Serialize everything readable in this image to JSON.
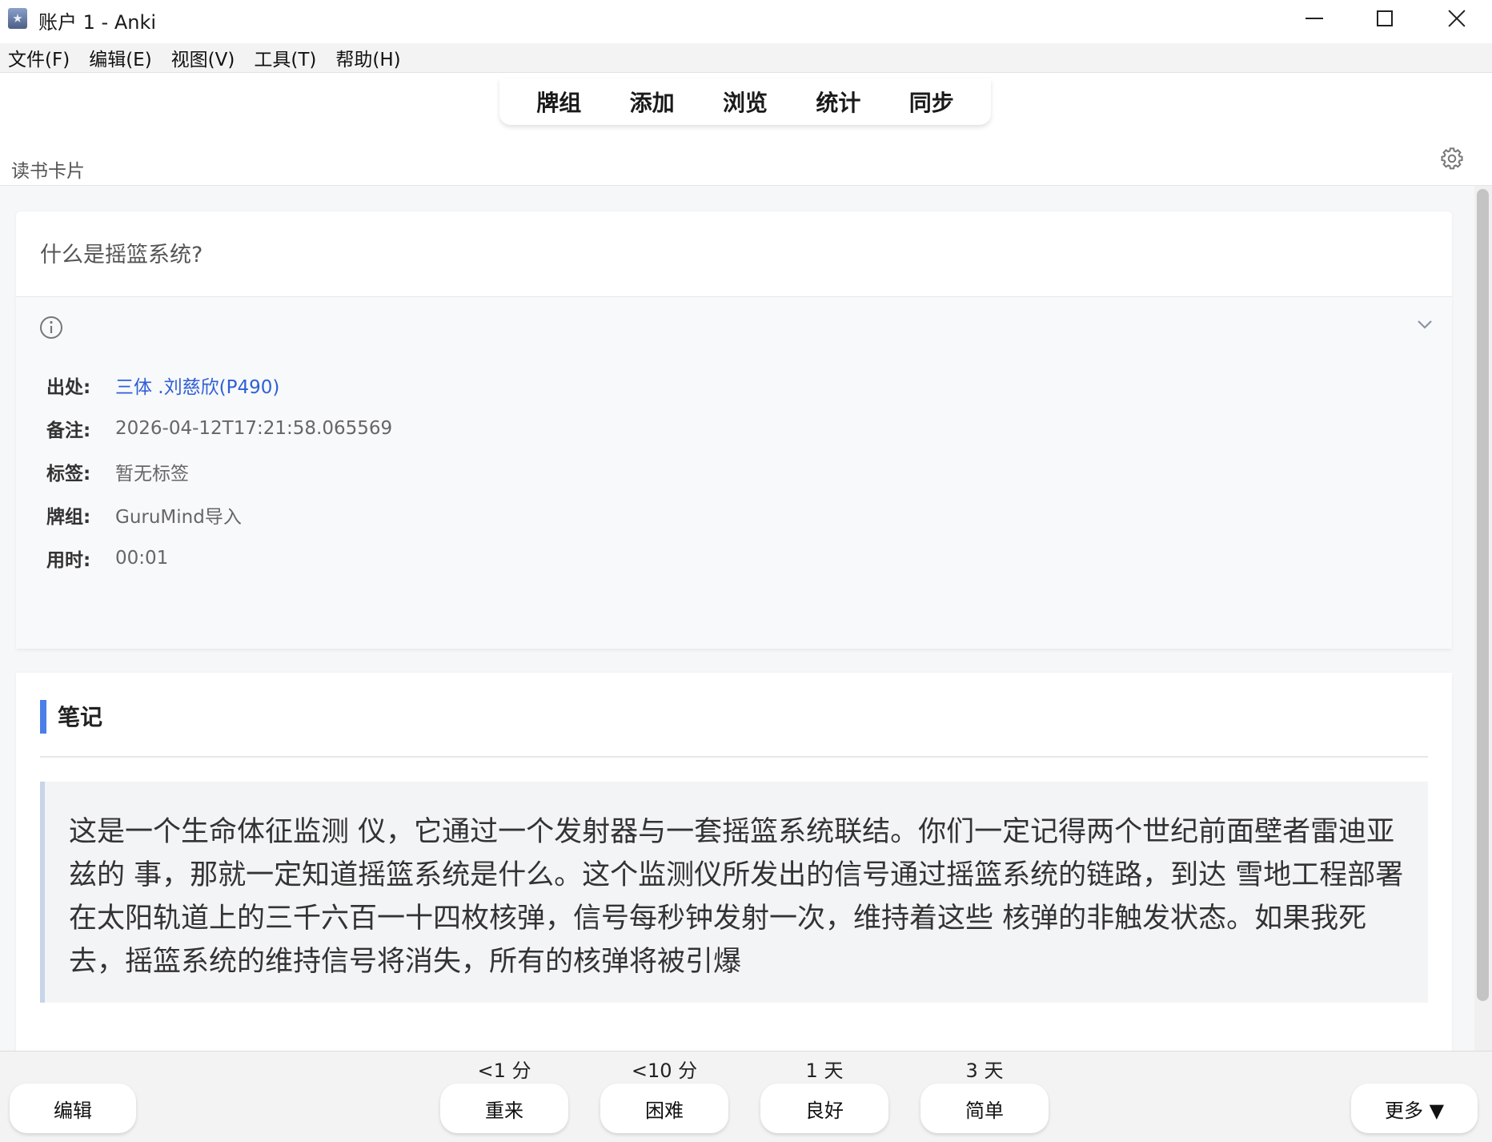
{
  "window": {
    "title": "账户 1 - Anki"
  },
  "menu": [
    "文件(F)",
    "编辑(E)",
    "视图(V)",
    "工具(T)",
    "帮助(H)"
  ],
  "toolbar": [
    "牌组",
    "添加",
    "浏览",
    "统计",
    "同步"
  ],
  "deck": {
    "name": "读书卡片"
  },
  "question": "什么是摇篮系统?",
  "info": {
    "rows": [
      {
        "label": "出处:",
        "value": "三体 .刘慈欣(P490)"
      },
      {
        "label": "备注:",
        "value": "2026-04-12T17:21:58.065569"
      },
      {
        "label": "标签:",
        "value": "暂无标签"
      },
      {
        "label": "牌组:",
        "value": "GuruMind导入"
      },
      {
        "label": "用时:",
        "value": "00:01"
      }
    ]
  },
  "notes": {
    "title": "笔记",
    "text": "这是一个生命体征监测 仪，它通过一个发射器与一套摇篮系统联结。你们一定记得两个世纪前面壁者雷迪亚兹的 事，那就一定知道摇篮系统是什么。这个监测仪所发出的信号通过摇篮系统的链路，到达 雪地工程部署在太阳轨道上的三千六百一十四枚核弹，信号每秒钟发射一次，维持着这些 核弹的非触发状态。如果我死去，摇篮系统的维持信号将消失，所有的核弹将被引爆"
  },
  "bottom": {
    "edit_label": "编辑",
    "more_label": "更多 ▼",
    "answers": [
      {
        "interval": "<1 分",
        "label": "重来"
      },
      {
        "interval": "<10 分",
        "label": "困难"
      },
      {
        "interval": "1 天",
        "label": "良好"
      },
      {
        "interval": "3 天",
        "label": "简单"
      }
    ]
  },
  "colors": {
    "accent": "#4a7fe8",
    "link": "#2f5fd6"
  }
}
